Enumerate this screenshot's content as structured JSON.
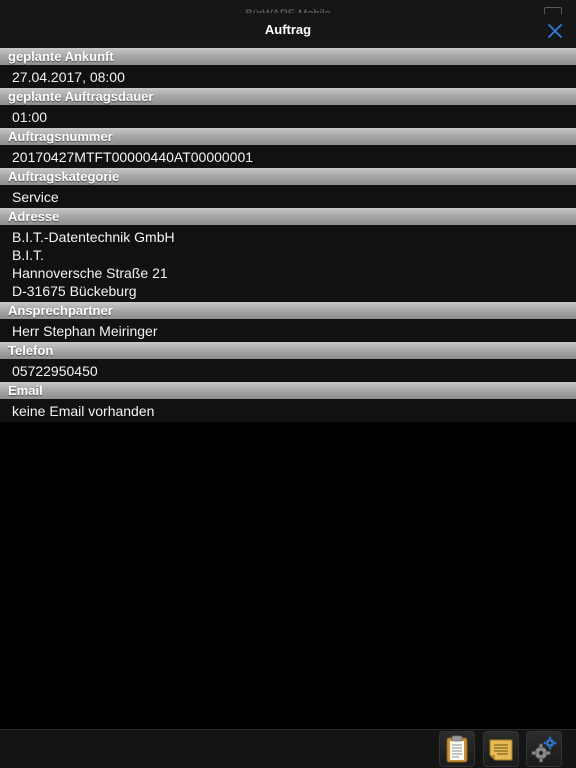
{
  "window": {
    "behind_title": "BürWARE Mobile",
    "title": "Auftrag"
  },
  "fields": [
    {
      "label": "geplante Ankunft",
      "lines": [
        "27.04.2017, 08:00"
      ]
    },
    {
      "label": "geplante Auftragsdauer",
      "lines": [
        "01:00"
      ]
    },
    {
      "label": "Auftragsnummer",
      "lines": [
        "20170427MTFT00000440AT00000001"
      ]
    },
    {
      "label": "Auftragskategorie",
      "lines": [
        "Service"
      ]
    },
    {
      "label": "Adresse",
      "lines": [
        "B.I.T.-Datentechnik GmbH",
        "B.I.T.",
        "Hannoversche Straße 21",
        "D-31675 Bückeburg"
      ]
    },
    {
      "label": "Ansprechpartner",
      "lines": [
        "Herr Stephan Meiringer"
      ]
    },
    {
      "label": "Telefon",
      "lines": [
        "05722950450"
      ]
    },
    {
      "label": "Email",
      "lines": [
        "keine Email vorhanden"
      ]
    }
  ],
  "toolbar": {
    "buttons": [
      {
        "icon": "clipboard-icon"
      },
      {
        "icon": "notes-icon"
      },
      {
        "icon": "gears-icon"
      }
    ]
  },
  "colors": {
    "accent": "#2f7de1",
    "header_gradient_top": "#c9c9c9",
    "header_gradient_bottom": "#8e8e8e",
    "background": "#111111"
  }
}
